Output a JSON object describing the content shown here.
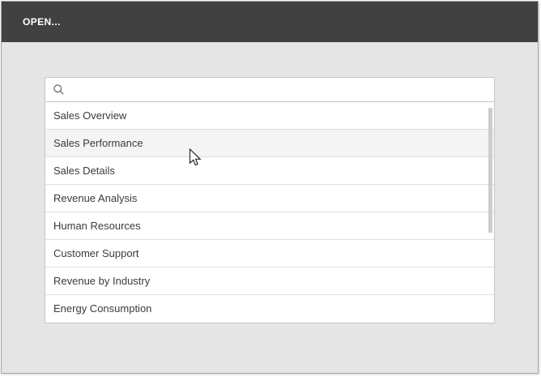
{
  "dialog": {
    "title": "OPEN..."
  },
  "search": {
    "placeholder": "",
    "value": "",
    "icon": "search-icon"
  },
  "list": {
    "items": [
      "Sales Overview",
      "Sales Performance",
      "Sales Details",
      "Revenue Analysis",
      "Human Resources",
      "Customer Support",
      "Revenue by Industry",
      "Energy Consumption"
    ],
    "hovered_index": 1,
    "scrollbar_visible": true
  },
  "colors": {
    "header_bg": "#414141",
    "title_color": "#ffffff",
    "body_bg": "#e5e5e5",
    "panel_bg": "#ffffff",
    "hover_bg": "#f4f4f4",
    "border": "#c6c6c6",
    "row_divider": "#e0e0e0",
    "dialog_border": "#a6a6a6",
    "scrollbar_thumb": "#cdcdcd",
    "text_color": "#3b3b3b",
    "icon_color": "#757575"
  }
}
